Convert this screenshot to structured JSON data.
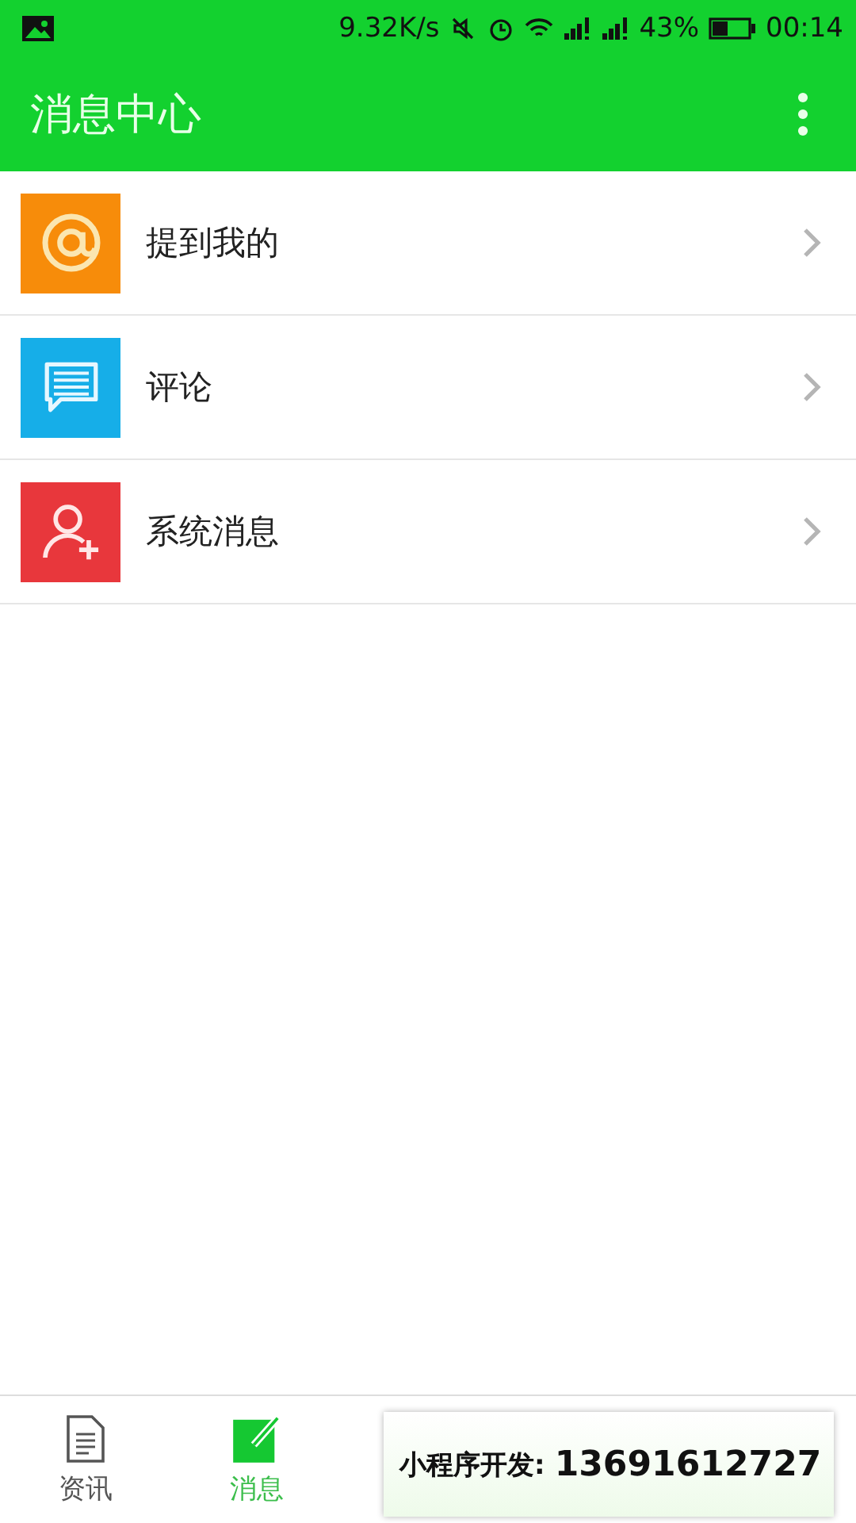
{
  "status_bar": {
    "speed": "9.32K/s",
    "battery": "43%",
    "time": "00:14"
  },
  "app_bar": {
    "title": "消息中心"
  },
  "items": [
    {
      "label": "提到我的",
      "kind": "at",
      "color": "#f78c0a"
    },
    {
      "label": "评论",
      "kind": "comment",
      "color": "#16aee8"
    },
    {
      "label": "系统消息",
      "kind": "user-add",
      "color": "#e8373c"
    }
  ],
  "tabs": [
    {
      "label": "资讯",
      "kind": "doc",
      "selected": false
    },
    {
      "label": "消息",
      "kind": "edit",
      "selected": true
    }
  ],
  "banner": {
    "label": "小程序开发:",
    "phone": "13691612727"
  }
}
